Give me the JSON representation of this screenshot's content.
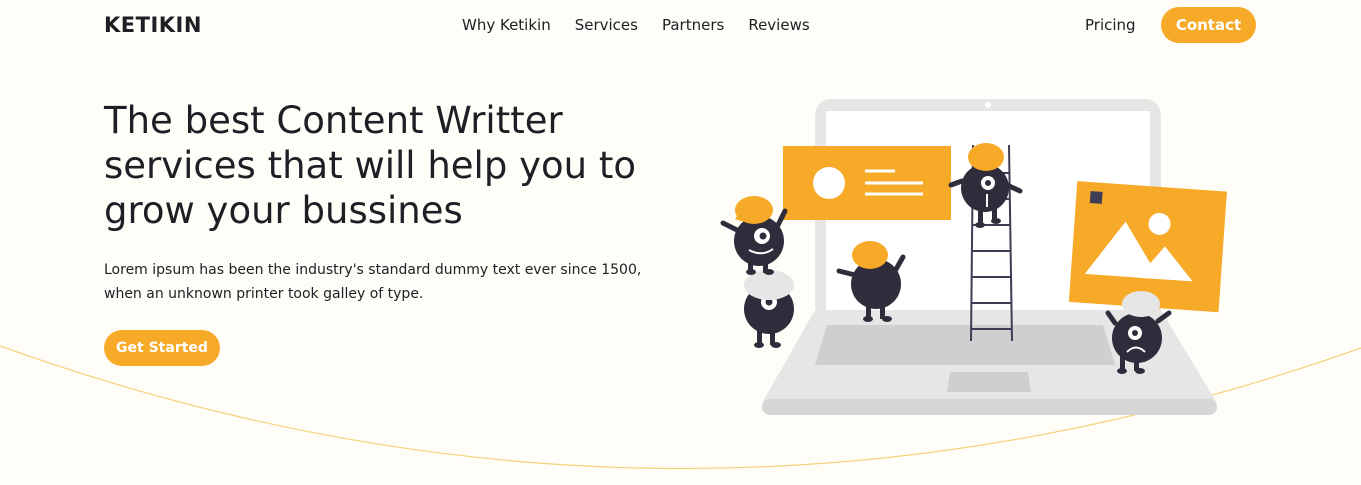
{
  "brand": {
    "name": "KETIKIN"
  },
  "nav": {
    "items": [
      {
        "label": "Why Ketikin"
      },
      {
        "label": "Services"
      },
      {
        "label": "Partners"
      },
      {
        "label": "Reviews"
      }
    ],
    "pricing_label": "Pricing",
    "contact_label": "Contact"
  },
  "hero": {
    "title": "The best Content Writter services that will help you to grow your bussines",
    "body": "Lorem ipsum has been the industry's standard dummy text ever since 1500, when an unknown printer took galley of type.",
    "cta_label": "Get Started"
  },
  "colors": {
    "accent": "#f7a928",
    "text": "#1e1e24",
    "background": "#fffdf8",
    "character": "#2f2c3c",
    "laptop": "#e6e6e6"
  },
  "illustration": {
    "icons": [
      "laptop-icon",
      "profile-card-icon",
      "image-card-icon",
      "ladder-icon",
      "character-icon"
    ]
  }
}
